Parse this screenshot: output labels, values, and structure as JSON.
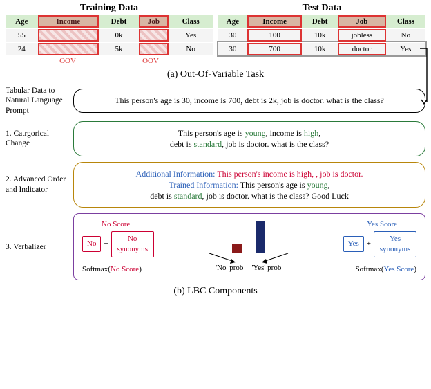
{
  "top": {
    "train_title": "Training Data",
    "test_title": "Test Data",
    "train_headers": [
      "Age",
      "Income",
      "Debt",
      "Job",
      "Class"
    ],
    "train_rows": [
      {
        "age": "55",
        "income": "",
        "debt": "0k",
        "job": "",
        "class": "Yes"
      },
      {
        "age": "24",
        "income": "",
        "debt": "5k",
        "job": "",
        "class": "No"
      }
    ],
    "test_headers": [
      "Age",
      "Income",
      "Debt",
      "Job",
      "Class"
    ],
    "test_rows": [
      {
        "age": "30",
        "income": "100",
        "debt": "10k",
        "job": "jobless",
        "class": "No"
      },
      {
        "age": "30",
        "income": "700",
        "debt": "10k",
        "job": "doctor",
        "class": "Yes"
      }
    ],
    "oov_label": "OOV"
  },
  "captions": {
    "a": "(a) Out-Of-Variable Task",
    "b": "(b) LBC Components"
  },
  "steps": {
    "s0_label": "Tabular Data to Natural Language Prompt",
    "s0_text": "This person's age is 30, income is 700, debt is 2k, job is doctor. what is the class?",
    "s1_label": "1. Catrgorical Change",
    "s1_pre": "This person's age is ",
    "s1_v1": "young",
    "s1_mid1": ", income is ",
    "s1_v2": "high",
    "s1_mid2": ",\ndebt is ",
    "s1_v3": "standard",
    "s1_post": ", job is doctor. what is the class?",
    "s2_label": "2. Advanced Order and Indicator",
    "s2_ai": "Additional Information: ",
    "s2_ai_body": "This person's income is high, , job is doctor.",
    "s2_ti": "Trained Information: ",
    "s2_ti_pre": "This person's age is ",
    "s2_ti_v1": "young",
    "s2_ti_mid": ",\ndebt is ",
    "s2_ti_v2": "standard",
    "s2_ti_post": ", job is doctor. what is the class? Good Luck",
    "s3_label": "3. Verbalizer"
  },
  "verb": {
    "no_score_title": "No Score",
    "no_box": "No",
    "plus": "+",
    "no_syn": "No synonyms",
    "softmax_no_a": "Softmax(",
    "softmax_no_b": "No Score",
    "softmax_no_c": ")",
    "no_prob": "'No' prob",
    "yes_prob": "'Yes' prob",
    "yes_score_title": "Yes Score",
    "yes_box": "Yes",
    "yes_syn": "Yes synonyms",
    "softmax_yes_a": "Softmax(",
    "softmax_yes_b": "Yes Score",
    "softmax_yes_c": ")"
  }
}
